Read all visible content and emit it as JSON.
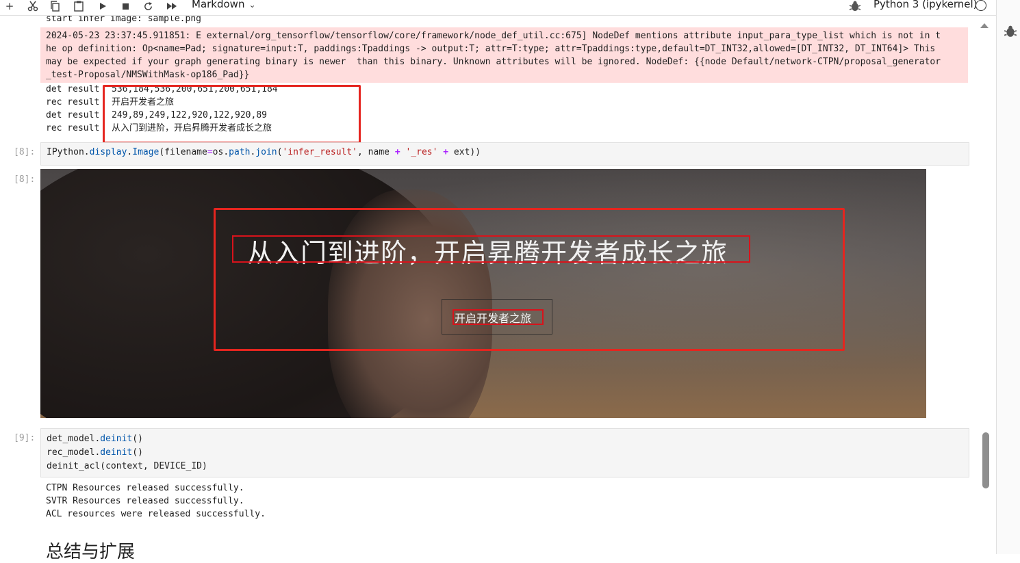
{
  "toolbar": {
    "cell_type": "Markdown",
    "kernel_name": "Python 3 (ipykernel)"
  },
  "output_top": {
    "start_line": "start infer image: sample.png",
    "stderr": [
      "2024-05-23 23:37:45.911851: E external/org_tensorflow/tensorflow/core/framework/node_def_util.cc:675] NodeDef mentions attribute input_para_type_list which is not in t",
      "he op definition: Op<name=Pad; signature=input:T, paddings:Tpaddings -> output:T; attr=T:type; attr=Tpaddings:type,default=DT_INT32,allowed=[DT_INT32, DT_INT64]> This",
      "may be expected if your graph generating binary is newer  than this binary. Unknown attributes will be ignored. NodeDef: {{node Default/network-CTPN/proposal_generator",
      "_test-Proposal/NMSWithMask-op186_Pad}}"
    ],
    "results": [
      {
        "label": "det result",
        "value": "536,184,536,200,651,200,651,184"
      },
      {
        "label": "rec result",
        "value": "开启开发者之旅"
      },
      {
        "label": "det result",
        "value": "249,89,249,122,920,122,920,89"
      },
      {
        "label": "rec result",
        "value": "从入门到进阶，开启昇腾开发者成长之旅"
      }
    ]
  },
  "cell8": {
    "prompt_in": "[8]:",
    "prompt_out": "[8]:",
    "code": {
      "p1": "IPython.",
      "p2": "display",
      "p3": ".",
      "p4": "Image",
      "p5": "(filename",
      "p6": "=",
      "p7": "os.",
      "p8": "path",
      "p9": ".",
      "p10": "join",
      "p11": "(",
      "p12": "'infer_result'",
      "p13": ", name ",
      "p14": "+",
      "p15": " ",
      "p16": "'_res'",
      "p17": " ",
      "p18": "+",
      "p19": " ext))"
    },
    "image": {
      "headline": "从入门到进阶，开启昇腾开发者成长之旅",
      "button_text": "开启开发者之旅"
    }
  },
  "cell9": {
    "prompt": "[9]:",
    "lines": [
      {
        "a": "det_model.",
        "b": "deinit",
        "c": "()"
      },
      {
        "a": "rec_model.",
        "b": "deinit",
        "c": "()"
      },
      {
        "a": "deinit_acl(context, DEVICE_ID)",
        "b": "",
        "c": ""
      }
    ],
    "output": [
      "CTPN Resources released successfully.",
      "SVTR Resources released successfully.",
      "ACL resources were released successfully."
    ]
  },
  "heading": "总结与扩展",
  "colors": {
    "annotation_red": "#e5251f",
    "stderr_bg": "#ffdddd",
    "cell_bg": "#f5f5f5"
  }
}
